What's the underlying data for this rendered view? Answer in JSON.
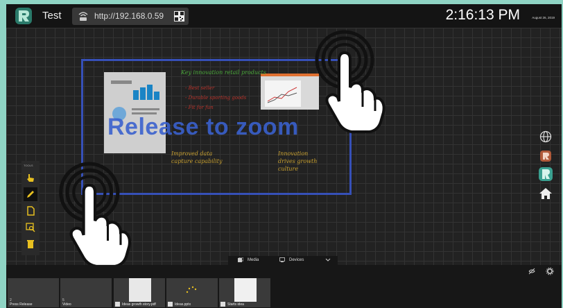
{
  "topbar": {
    "title": "Test",
    "url": "http://192.168.0.59",
    "time": "2:16:13 PM",
    "date": "August 26, 2019"
  },
  "canvas": {
    "overlay_text": "Release to zoom",
    "notes": {
      "heading": "Key innovation retail products",
      "bullets": [
        "- Best seller",
        "- Durable sporting goods",
        "- Fit for fun"
      ],
      "left_caption": [
        "Improved data",
        "capture capability"
      ],
      "right_caption": [
        "Innovation",
        "drives growth",
        "culture"
      ]
    }
  },
  "left_tools": {
    "label": "TOOLS",
    "items": [
      "select-tool",
      "pen-tool",
      "page-tool",
      "zoom-tool",
      "delete-tool"
    ]
  },
  "right_tools": [
    "globe-icon",
    "app-icon",
    "logo-icon",
    "home-icon"
  ],
  "bottom": {
    "tabs": [
      "Media",
      "Devices"
    ],
    "tiles": [
      {
        "count": "2",
        "label": "Press Release"
      },
      {
        "count": "5",
        "label": "Video"
      },
      {
        "label": "Ideas growth story.pdf"
      },
      {
        "label": "Ideas.pptx"
      },
      {
        "label": "Starts idea"
      }
    ]
  },
  "colors": {
    "accent_blue": "#3650b8",
    "canvas_bg": "#222222",
    "border_teal": "#8fd4c4"
  }
}
